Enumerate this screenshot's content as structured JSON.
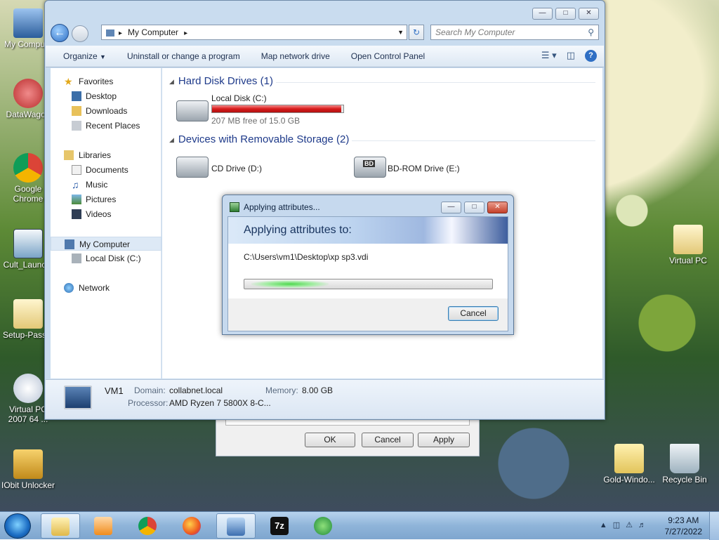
{
  "desktop": {
    "icons": [
      {
        "label": "My Compu..."
      },
      {
        "label": "DataWagon"
      },
      {
        "label": "Google Chrome"
      },
      {
        "label": "Cult_Launc..."
      },
      {
        "label": "Setup-Pass..."
      },
      {
        "label": "Virtual PC 2007 64 ..."
      },
      {
        "label": "IObit Unlocker"
      },
      {
        "label": "Virtual PC"
      },
      {
        "label": "Gold-Windo..."
      },
      {
        "label": "Recycle Bin"
      }
    ]
  },
  "explorer": {
    "address": {
      "path": "My Computer"
    },
    "search": {
      "placeholder": "Search My Computer"
    },
    "toolbar": {
      "organize": "Organize",
      "uninstall": "Uninstall or change a program",
      "map_drive": "Map network drive",
      "control_panel": "Open Control Panel"
    },
    "nav": {
      "favorites": "Favorites",
      "desktop": "Desktop",
      "downloads": "Downloads",
      "recent": "Recent Places",
      "libraries": "Libraries",
      "documents": "Documents",
      "music": "Music",
      "pictures": "Pictures",
      "videos": "Videos",
      "my_computer": "My Computer",
      "local_disk": "Local Disk (C:)",
      "network": "Network"
    },
    "groups": {
      "hdd": "Hard Disk Drives (1)",
      "removable": "Devices with Removable Storage (2)"
    },
    "drives": {
      "c": {
        "name": "Local Disk (C:)",
        "free": "207 MB free of 15.0 GB",
        "used_fraction": 0.986
      },
      "d": {
        "name": "CD Drive (D:)"
      },
      "e": {
        "name": "BD-ROM Drive (E:)",
        "badge": "BD"
      }
    },
    "details": {
      "name": "VM1",
      "domain_label": "Domain:",
      "domain": "collabnet.local",
      "memory_label": "Memory:",
      "memory": "8.00 GB",
      "processor_label": "Processor:",
      "processor": "AMD Ryzen 7 5800X 8-C..."
    }
  },
  "props_dialog": {
    "ok": "OK",
    "cancel": "Cancel",
    "apply": "Apply"
  },
  "progress_dialog": {
    "title": "Applying attributes...",
    "heading": "Applying attributes to:",
    "path": "C:\\Users\\vm1\\Desktop\\xp sp3.vdi",
    "cancel": "Cancel"
  },
  "taskbar": {
    "time": "9:23 AM",
    "date": "7/27/2022"
  },
  "colors": {
    "accent": "#2f6fc4",
    "disk_full": "#d81c1c",
    "progress": "#4fd84f"
  }
}
